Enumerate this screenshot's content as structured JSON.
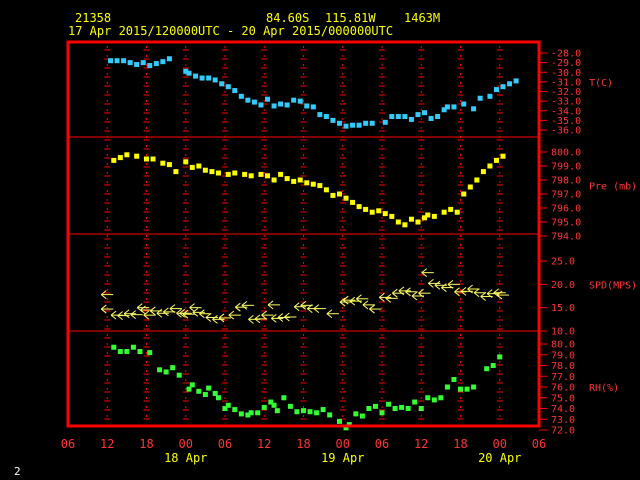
{
  "header": {
    "station": "21358",
    "lat": "84.60S",
    "lon": "115.81W",
    "elev": "1463M",
    "period": "17 Apr 2015/120000UTC - 20 Apr 2015/000000UTC"
  },
  "corner_label": "2",
  "colors": {
    "frame": "#ff0000",
    "axis_text": "#ff3333",
    "header_text": "#ffff00",
    "temperature": "#33ccff",
    "pressure": "#ffff00",
    "wind": "#ffff66",
    "humidity": "#33ff33"
  },
  "chart_data": {
    "type": "scatter",
    "x_axis": {
      "unit": "hours since 17 Apr 2015 06 UTC",
      "range": [
        0,
        72
      ],
      "tick_every": 6,
      "tick_labels": [
        "06",
        "12",
        "18",
        "00",
        "06",
        "12",
        "18",
        "00",
        "06",
        "12",
        "18",
        "00",
        "06"
      ],
      "day_labels": [
        {
          "at": 18,
          "label": "18 Apr"
        },
        {
          "at": 42,
          "label": "19 Apr"
        },
        {
          "at": 66,
          "label": "20 Apr"
        }
      ]
    },
    "panels": [
      {
        "key": "temp",
        "label": "T(C)",
        "ylim": [
          -36,
          -28
        ],
        "yticks": [
          -28,
          -29,
          -30,
          -31,
          -32,
          -33,
          -34,
          -35,
          -36
        ],
        "tick_labels": [
          "-28.0",
          "-29.0",
          "-30.0",
          "-31.0",
          "-32.0",
          "-33.0",
          "-34.0",
          "-35.0",
          "-36.0"
        ],
        "points": [
          [
            6.5,
            -28.8
          ],
          [
            7.5,
            -28.8
          ],
          [
            8.5,
            -28.8
          ],
          [
            9.5,
            -29.0
          ],
          [
            10.5,
            -29.2
          ],
          [
            11.5,
            -29.0
          ],
          [
            12.5,
            -29.3
          ],
          [
            13.5,
            -29.1
          ],
          [
            14.5,
            -28.9
          ],
          [
            15.5,
            -28.6
          ],
          [
            18.0,
            -29.9
          ],
          [
            18.5,
            -30.1
          ],
          [
            19.5,
            -30.4
          ],
          [
            20.5,
            -30.6
          ],
          [
            21.5,
            -30.6
          ],
          [
            22.5,
            -30.8
          ],
          [
            23.5,
            -31.2
          ],
          [
            24.5,
            -31.5
          ],
          [
            25.5,
            -31.9
          ],
          [
            26.5,
            -32.5
          ],
          [
            27.5,
            -32.9
          ],
          [
            28.5,
            -33.1
          ],
          [
            29.5,
            -33.4
          ],
          [
            30.5,
            -32.8
          ],
          [
            31.5,
            -33.5
          ],
          [
            32.5,
            -33.3
          ],
          [
            33.5,
            -33.4
          ],
          [
            34.5,
            -32.9
          ],
          [
            35.5,
            -33.0
          ],
          [
            36.5,
            -33.5
          ],
          [
            37.5,
            -33.6
          ],
          [
            38.5,
            -34.4
          ],
          [
            39.5,
            -34.6
          ],
          [
            40.5,
            -35.0
          ],
          [
            41.5,
            -35.3
          ],
          [
            42.5,
            -35.6
          ],
          [
            43.5,
            -35.5
          ],
          [
            44.5,
            -35.5
          ],
          [
            45.5,
            -35.3
          ],
          [
            46.5,
            -35.3
          ],
          [
            48.5,
            -35.2
          ],
          [
            49.5,
            -34.6
          ],
          [
            50.5,
            -34.6
          ],
          [
            51.5,
            -34.6
          ],
          [
            52.5,
            -34.9
          ],
          [
            53.5,
            -34.4
          ],
          [
            54.5,
            -34.2
          ],
          [
            55.5,
            -34.8
          ],
          [
            56.5,
            -34.6
          ],
          [
            57.5,
            -33.9
          ],
          [
            58.0,
            -33.6
          ],
          [
            59.0,
            -33.6
          ],
          [
            60.5,
            -33.3
          ],
          [
            62.0,
            -33.8
          ],
          [
            63.0,
            -32.7
          ],
          [
            64.5,
            -32.5
          ],
          [
            65.5,
            -31.8
          ],
          [
            66.5,
            -31.5
          ],
          [
            67.5,
            -31.2
          ],
          [
            68.5,
            -30.9
          ]
        ]
      },
      {
        "key": "pres",
        "label": "Pre (mb)",
        "ylim": [
          794,
          800
        ],
        "yticks": [
          800,
          799,
          798,
          797,
          796,
          795,
          794
        ],
        "tick_labels": [
          "800.0",
          "799.0",
          "798.0",
          "797.0",
          "796.0",
          "795.0",
          "794.0"
        ],
        "points": [
          [
            7.0,
            799.4
          ],
          [
            8.0,
            799.6
          ],
          [
            9.0,
            799.8
          ],
          [
            10.5,
            799.7
          ],
          [
            12.0,
            799.5
          ],
          [
            13.0,
            799.5
          ],
          [
            14.5,
            799.2
          ],
          [
            15.5,
            799.1
          ],
          [
            16.5,
            798.6
          ],
          [
            18.0,
            799.3
          ],
          [
            19.0,
            798.9
          ],
          [
            20.0,
            799.0
          ],
          [
            21.0,
            798.7
          ],
          [
            22.0,
            798.6
          ],
          [
            23.0,
            798.5
          ],
          [
            24.5,
            798.4
          ],
          [
            25.5,
            798.5
          ],
          [
            27.0,
            798.4
          ],
          [
            28.0,
            798.3
          ],
          [
            29.5,
            798.4
          ],
          [
            30.5,
            798.3
          ],
          [
            31.5,
            798.0
          ],
          [
            32.5,
            798.4
          ],
          [
            33.5,
            798.1
          ],
          [
            34.5,
            797.9
          ],
          [
            35.5,
            798.0
          ],
          [
            36.5,
            797.8
          ],
          [
            37.5,
            797.7
          ],
          [
            38.5,
            797.6
          ],
          [
            39.5,
            797.3
          ],
          [
            40.5,
            796.9
          ],
          [
            41.5,
            797.0
          ],
          [
            42.5,
            796.7
          ],
          [
            43.5,
            796.4
          ],
          [
            44.5,
            796.1
          ],
          [
            45.5,
            795.9
          ],
          [
            46.5,
            795.7
          ],
          [
            47.5,
            795.8
          ],
          [
            48.5,
            795.6
          ],
          [
            49.5,
            795.4
          ],
          [
            50.5,
            795.0
          ],
          [
            51.5,
            794.8
          ],
          [
            52.5,
            795.2
          ],
          [
            53.5,
            795.0
          ],
          [
            54.5,
            795.3
          ],
          [
            55.0,
            795.5
          ],
          [
            56.0,
            795.4
          ],
          [
            57.5,
            795.7
          ],
          [
            58.5,
            795.9
          ],
          [
            59.5,
            795.7
          ],
          [
            60.5,
            797.0
          ],
          [
            61.5,
            797.5
          ],
          [
            62.5,
            798.0
          ],
          [
            63.5,
            798.6
          ],
          [
            64.5,
            799.0
          ],
          [
            65.5,
            799.4
          ],
          [
            66.5,
            799.7
          ]
        ]
      },
      {
        "key": "spd",
        "label": "SPD(MPS)",
        "ylim": [
          10,
          25
        ],
        "yticks": [
          25,
          20,
          15,
          10
        ],
        "tick_labels": [
          "25.0",
          "20.0",
          "15.0",
          "10.0"
        ],
        "points": [
          [
            6.0,
            17.8
          ],
          [
            6.0,
            14.7
          ],
          [
            7.5,
            13.4
          ],
          [
            8.5,
            13.3
          ],
          [
            9.5,
            13.7
          ],
          [
            10.5,
            13.5
          ],
          [
            11.5,
            15.0
          ],
          [
            12.0,
            14.5
          ],
          [
            12.5,
            13.4
          ],
          [
            13.5,
            14.3
          ],
          [
            14.5,
            13.8
          ],
          [
            15.5,
            14.1
          ],
          [
            16.5,
            14.8
          ],
          [
            17.5,
            13.8
          ],
          [
            18.0,
            13.8
          ],
          [
            18.5,
            13.6
          ],
          [
            19.5,
            15.0
          ],
          [
            20.0,
            14.0
          ],
          [
            21.0,
            13.7
          ],
          [
            22.0,
            12.9
          ],
          [
            23.0,
            12.5
          ],
          [
            24.0,
            12.8
          ],
          [
            25.5,
            13.4
          ],
          [
            26.5,
            15.1
          ],
          [
            27.5,
            15.5
          ],
          [
            28.5,
            12.5
          ],
          [
            29.5,
            12.6
          ],
          [
            30.5,
            13.4
          ],
          [
            31.5,
            15.6
          ],
          [
            32.0,
            12.7
          ],
          [
            33.0,
            12.9
          ],
          [
            34.0,
            13.0
          ],
          [
            35.5,
            15.2
          ],
          [
            36.5,
            15.5
          ],
          [
            37.5,
            14.8
          ],
          [
            38.5,
            14.8
          ],
          [
            40.5,
            13.7
          ],
          [
            42.5,
            16.2
          ],
          [
            43.0,
            16.6
          ],
          [
            44.0,
            16.4
          ],
          [
            45.0,
            16.9
          ],
          [
            46.0,
            15.6
          ],
          [
            47.0,
            14.7
          ],
          [
            48.5,
            17.2
          ],
          [
            49.5,
            17.0
          ],
          [
            50.5,
            18.1
          ],
          [
            51.5,
            18.6
          ],
          [
            52.5,
            18.4
          ],
          [
            53.5,
            17.5
          ],
          [
            54.5,
            18.1
          ],
          [
            55.0,
            22.5
          ],
          [
            56.0,
            20.2
          ],
          [
            57.0,
            19.8
          ],
          [
            58.0,
            19.3
          ],
          [
            59.0,
            20.0
          ],
          [
            60.0,
            18.4
          ],
          [
            61.0,
            18.5
          ],
          [
            62.0,
            19.0
          ],
          [
            63.0,
            18.2
          ],
          [
            64.0,
            17.4
          ],
          [
            65.0,
            18.0
          ],
          [
            66.0,
            18.2
          ],
          [
            66.5,
            17.7
          ]
        ]
      },
      {
        "key": "rh",
        "label": "RH(%)",
        "ylim": [
          72,
          80
        ],
        "yticks": [
          80,
          79,
          78,
          77,
          76,
          75,
          74,
          73,
          72
        ],
        "tick_labels": [
          "80.0",
          "79.0",
          "78.0",
          "77.0",
          "76.0",
          "75.0",
          "74.0",
          "73.0",
          "72.0"
        ],
        "points": [
          [
            7.0,
            79.7
          ],
          [
            8.0,
            79.3
          ],
          [
            9.0,
            79.3
          ],
          [
            10.0,
            79.7
          ],
          [
            11.0,
            79.3
          ],
          [
            12.5,
            79.2
          ],
          [
            14.0,
            77.6
          ],
          [
            15.0,
            77.4
          ],
          [
            16.0,
            77.8
          ],
          [
            17.0,
            77.1
          ],
          [
            18.5,
            75.8
          ],
          [
            19.0,
            76.2
          ],
          [
            20.0,
            75.6
          ],
          [
            21.0,
            75.3
          ],
          [
            21.5,
            75.9
          ],
          [
            22.5,
            75.4
          ],
          [
            23.0,
            75.0
          ],
          [
            24.0,
            74.0
          ],
          [
            24.5,
            74.3
          ],
          [
            25.5,
            73.9
          ],
          [
            26.5,
            73.5
          ],
          [
            27.5,
            73.4
          ],
          [
            28.0,
            73.6
          ],
          [
            29.0,
            73.6
          ],
          [
            30.0,
            74.1
          ],
          [
            31.0,
            74.6
          ],
          [
            31.5,
            74.3
          ],
          [
            32.0,
            73.8
          ],
          [
            33.0,
            75.0
          ],
          [
            34.0,
            74.2
          ],
          [
            35.0,
            73.7
          ],
          [
            36.0,
            73.8
          ],
          [
            37.0,
            73.7
          ],
          [
            38.0,
            73.6
          ],
          [
            39.0,
            73.9
          ],
          [
            40.0,
            73.4
          ],
          [
            41.5,
            72.8
          ],
          [
            42.5,
            72.2
          ],
          [
            43.0,
            72.5
          ],
          [
            44.0,
            73.5
          ],
          [
            45.0,
            73.3
          ],
          [
            46.0,
            74.0
          ],
          [
            47.0,
            74.2
          ],
          [
            48.0,
            73.6
          ],
          [
            49.0,
            74.4
          ],
          [
            50.0,
            74.0
          ],
          [
            51.0,
            74.1
          ],
          [
            52.0,
            74.0
          ],
          [
            53.0,
            74.6
          ],
          [
            54.0,
            74.0
          ],
          [
            55.0,
            75.0
          ],
          [
            56.0,
            74.8
          ],
          [
            57.0,
            75.0
          ],
          [
            58.0,
            76.0
          ],
          [
            59.0,
            76.7
          ],
          [
            60.0,
            75.8
          ],
          [
            61.0,
            75.8
          ],
          [
            62.0,
            76.0
          ],
          [
            64.0,
            77.7
          ],
          [
            65.0,
            78.0
          ],
          [
            66.0,
            78.8
          ]
        ]
      }
    ]
  }
}
